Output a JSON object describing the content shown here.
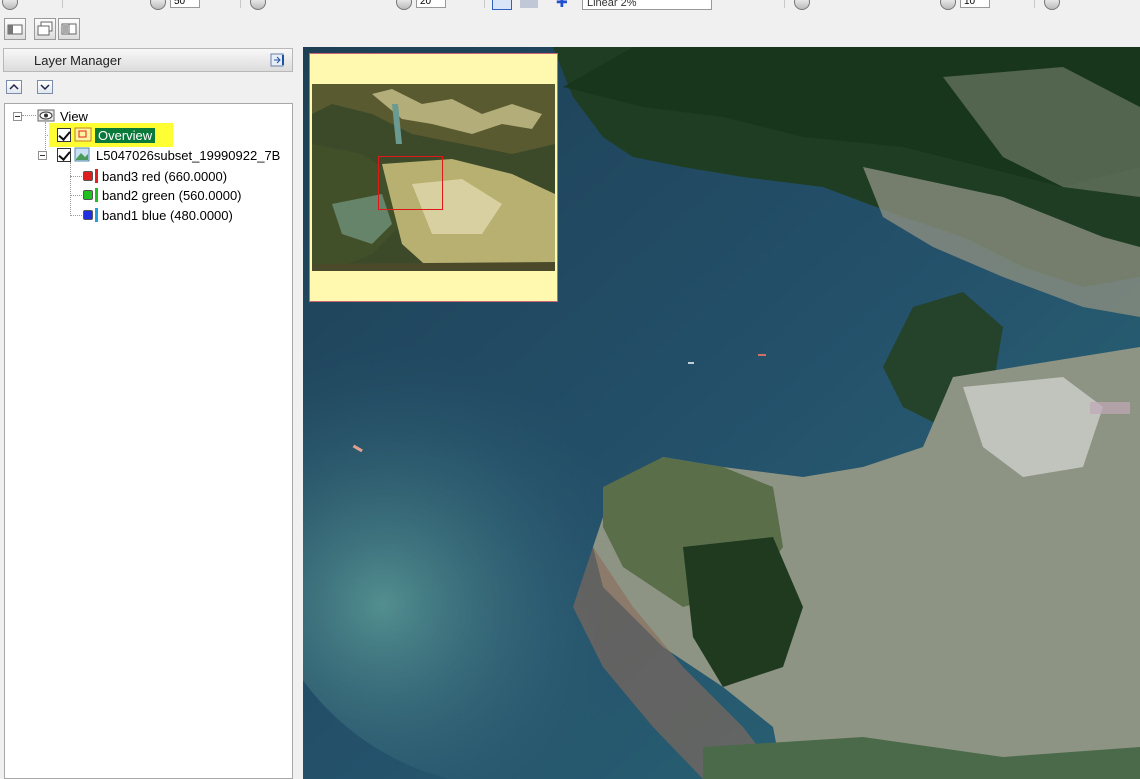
{
  "toolbar": {
    "zoom_value_1": "50",
    "zoom_value_2": "20",
    "stretch_select": "Linear 2%",
    "value_3": "10"
  },
  "layer_manager": {
    "title": "Layer Manager",
    "tree": {
      "view_label": "View",
      "overview_label": "Overview",
      "image_label": "L5047026subset_19990922_7B",
      "bands": [
        {
          "label": "band3 red (660.0000)",
          "color": "#e02020"
        },
        {
          "label": "band2 green (560.0000)",
          "color": "#20c020"
        },
        {
          "label": "band1 blue (480.0000)",
          "color": "#2030e0"
        }
      ]
    }
  },
  "colors": {
    "highlight": "#ffff33",
    "overview_selected_bg": "#0a7a3a",
    "overview_bg": "#fff9b0",
    "extent_box": "#e01818"
  }
}
